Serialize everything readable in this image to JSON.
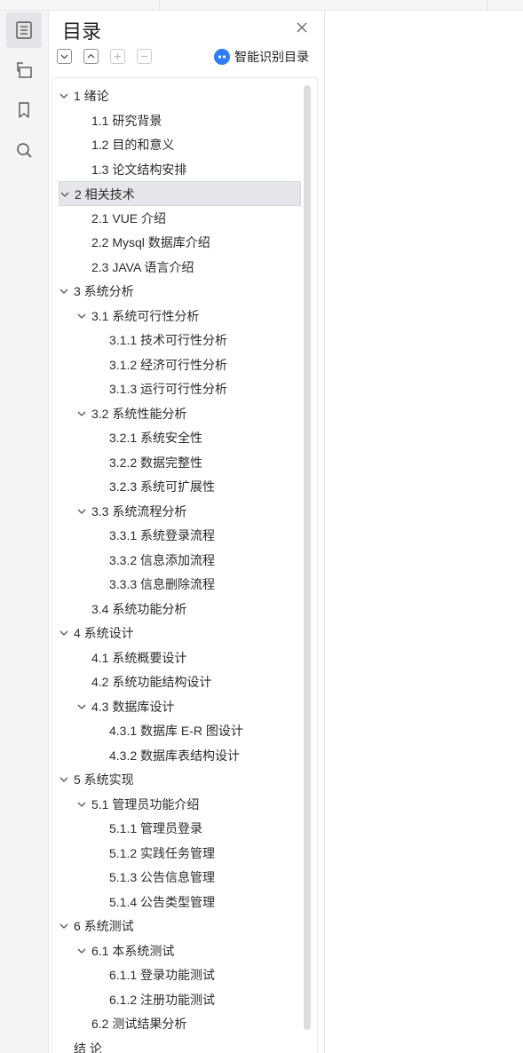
{
  "sidebar_tools": [
    {
      "name": "toc",
      "icon": "toc-list-icon",
      "active": true
    },
    {
      "name": "outline",
      "icon": "outline-tree-icon",
      "active": false
    },
    {
      "name": "bookmark",
      "icon": "bookmark-icon",
      "active": false
    },
    {
      "name": "search",
      "icon": "search-icon",
      "active": false
    }
  ],
  "panel": {
    "title": "目录",
    "close_icon": "close-icon",
    "toolbar": [
      {
        "icon": "collapse-all-icon",
        "enabled": true
      },
      {
        "icon": "expand-all-icon",
        "enabled": true
      },
      {
        "icon": "add-heading-icon",
        "enabled": false
      },
      {
        "icon": "remove-heading-icon",
        "enabled": false
      }
    ],
    "smart_toc_label": "智能识别目录",
    "accent_color": "#2f7cf6"
  },
  "toc": [
    {
      "text": "1  绪论",
      "level": 1,
      "expanded": true
    },
    {
      "text": "1.1  研究背景",
      "level": 2
    },
    {
      "text": "1.2 目的和意义",
      "level": 2
    },
    {
      "text": "1.3  论文结构安排",
      "level": 2
    },
    {
      "text": "2  相关技术",
      "level": 1,
      "expanded": true,
      "selected": true
    },
    {
      "text": "2.1 VUE 介绍",
      "level": 2
    },
    {
      "text": "2.2 Mysql 数据库介绍",
      "level": 2
    },
    {
      "text": "2.3 JAVA 语言介绍",
      "level": 2
    },
    {
      "text": "3  系统分析",
      "level": 1,
      "expanded": true
    },
    {
      "text": "3.1 系统可行性分析",
      "level": 2,
      "expanded": true
    },
    {
      "text": "3.1.1  技术可行性分析",
      "level": 3
    },
    {
      "text": "3.1.2  经济可行性分析",
      "level": 3
    },
    {
      "text": "3.1.3  运行可行性分析",
      "level": 3
    },
    {
      "text": "3.2 系统性能分析",
      "level": 2,
      "expanded": true
    },
    {
      "text": "3.2.1  系统安全性",
      "level": 3
    },
    {
      "text": "3.2.2  数据完整性",
      "level": 3
    },
    {
      "text": "3.2.3 系统可扩展性",
      "level": 3
    },
    {
      "text": "3.3 系统流程分析",
      "level": 2,
      "expanded": true
    },
    {
      "text": "3.3.1 系统登录流程",
      "level": 3
    },
    {
      "text": "3.3.2 信息添加流程",
      "level": 3
    },
    {
      "text": "3.3.3 信息删除流程",
      "level": 3
    },
    {
      "text": "3.4 系统功能分析",
      "level": 2
    },
    {
      "text": "4  系统设计",
      "level": 1,
      "expanded": true
    },
    {
      "text": "4.1 系统概要设计",
      "level": 2
    },
    {
      "text": "4.2 系统功能结构设计",
      "level": 2
    },
    {
      "text": "4.3 数据库设计",
      "level": 2,
      "expanded": true
    },
    {
      "text": "4.3.1 数据库 E-R 图设计",
      "level": 3
    },
    {
      "text": "4.3.2  数据库表结构设计",
      "level": 3
    },
    {
      "text": "5  系统实现",
      "level": 1,
      "expanded": true
    },
    {
      "text": "5.1 管理员功能介绍",
      "level": 2,
      "expanded": true
    },
    {
      "text": "5.1.1 管理员登录",
      "level": 3
    },
    {
      "text": "5.1.2  实践任务管理",
      "level": 3
    },
    {
      "text": "5.1.3  公告信息管理",
      "level": 3
    },
    {
      "text": "5.1.4 公告类型管理",
      "level": 3
    },
    {
      "text": "6 系统测试",
      "level": 1,
      "expanded": true
    },
    {
      "text": "6.1  本系统测试",
      "level": 2,
      "expanded": true
    },
    {
      "text": "6.1.1  登录功能测试",
      "level": 3
    },
    {
      "text": "6.1.2  注册功能测试",
      "level": 3
    },
    {
      "text": "6.2 测试结果分析",
      "level": 2
    },
    {
      "text": "结  论",
      "level": 1
    }
  ]
}
